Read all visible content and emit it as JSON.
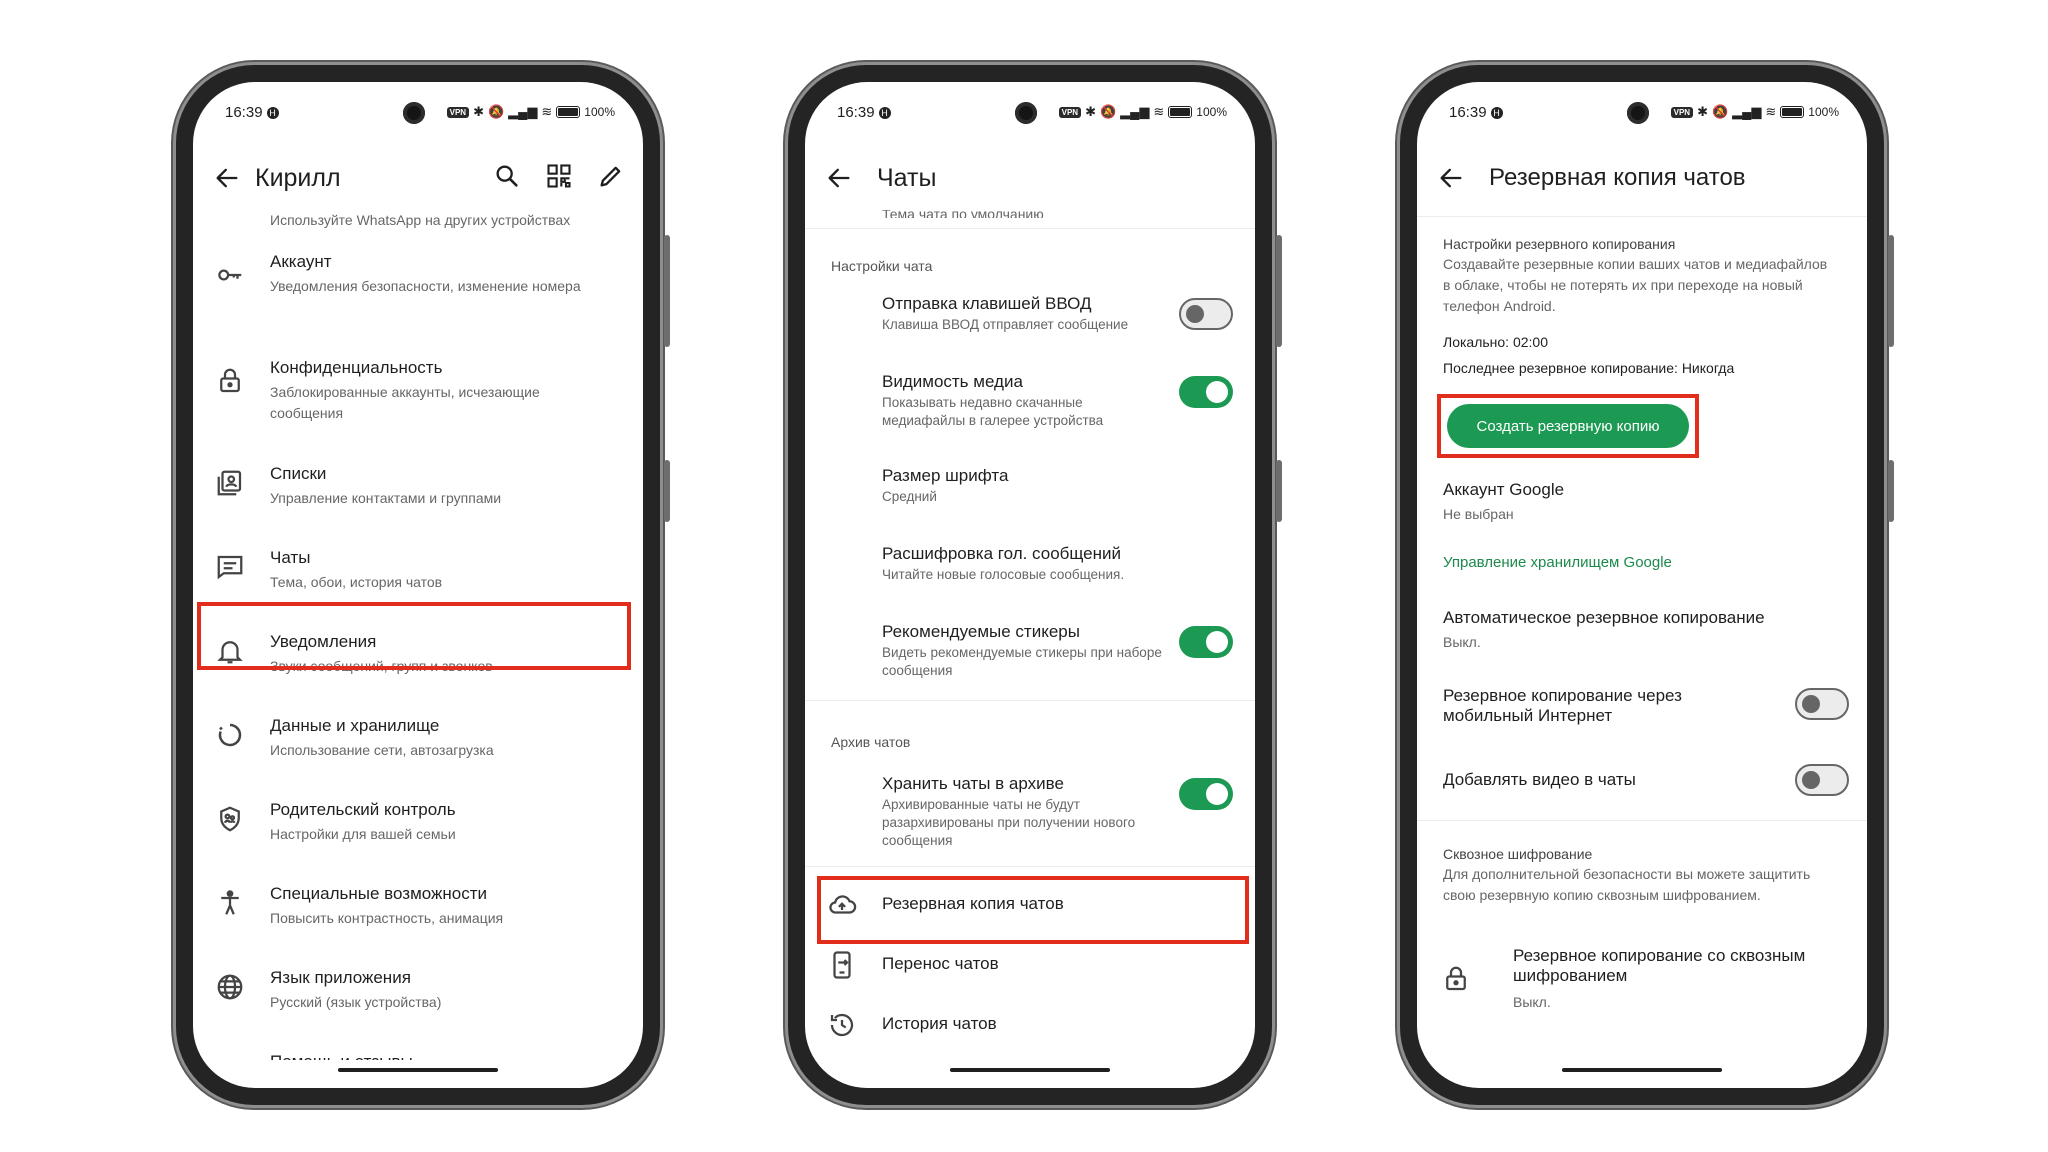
{
  "status": {
    "time": "16:39",
    "battery": "100%",
    "vpn": "VPN"
  },
  "screen1": {
    "title": "Кирилл",
    "top_cut": "Используйте WhatsApp на других устройствах",
    "items": [
      {
        "label": "Аккаунт",
        "sub": "Уведомления безопасности, изменение номера",
        "icon": "key-icon"
      },
      {
        "label": "Конфиденциальность",
        "sub": "Заблокированные аккаунты, исчезающие сообщения",
        "icon": "lock-icon"
      },
      {
        "label": "Списки",
        "sub": "Управление контактами и группами",
        "icon": "contacts-list-icon"
      },
      {
        "label": "Чаты",
        "sub": "Тема, обои, история чатов",
        "icon": "chat-icon"
      },
      {
        "label": "Уведомления",
        "sub": "Звуки сообщений, групп и звонков",
        "icon": "bell-icon"
      },
      {
        "label": "Данные и хранилище",
        "sub": "Использование сети, автозагрузка",
        "icon": "storage-circle-icon"
      },
      {
        "label": "Родительский контроль",
        "sub": "Настройки для вашей семьи",
        "icon": "family-shield-icon"
      },
      {
        "label": "Специальные возможности",
        "sub": "Повысить контрастность, анимация",
        "icon": "accessibility-icon"
      },
      {
        "label": "Язык приложения",
        "sub": "Русский (язык устройства)",
        "icon": "globe-icon"
      },
      {
        "label": "Помощь и отзывы",
        "sub": "",
        "icon": "help-icon"
      }
    ]
  },
  "screen2": {
    "title": "Чаты",
    "top_cut": "Тема чата по умолчанию",
    "section_chat": "Настройки чата",
    "enter_send": {
      "label": "Отправка клавишей ВВОД",
      "sub": "Клавиша ВВОД отправляет сообщение",
      "state": "off"
    },
    "media_visibility": {
      "label": "Видимость медиа",
      "sub": "Показывать недавно скачанные медиафайлы в галерее устройства",
      "state": "on"
    },
    "font_size": {
      "label": "Размер шрифта",
      "sub": "Средний"
    },
    "voice_transcripts": {
      "label": "Расшифровка гол. сообщений",
      "sub": "Читайте новые голосовые сообщения."
    },
    "suggested_stickers": {
      "label": "Рекомендуемые стикеры",
      "sub": "Видеть рекомендуемые стикеры при наборе сообщения",
      "state": "on"
    },
    "section_archive": "Архив чатов",
    "keep_archived": {
      "label": "Хранить чаты в архиве",
      "sub": "Архивированные чаты не будут разархивированы при получении нового сообщения",
      "state": "on"
    },
    "chat_backup": "Резервная копия чатов",
    "transfer_chats": "Перенос чатов",
    "chat_history": "История чатов"
  },
  "screen3": {
    "title": "Резервная копия чатов",
    "section_backup": "Настройки резервного копирования",
    "backup_desc": "Создавайте резервные копии ваших чатов и медиафайлов в облаке, чтобы не потерять их при переходе на новый телефон Android.",
    "local": "Локально: 02:00",
    "last_backup": "Последнее резервное копирование: Никогда",
    "backup_button": "Создать резервную копию",
    "google_account": {
      "label": "Аккаунт Google",
      "sub": "Не выбран"
    },
    "manage_storage": "Управление хранилищем Google",
    "auto_backup": {
      "label": "Автоматическое резервное копирование",
      "sub": "Выкл."
    },
    "cellular_backup": {
      "label": "Резервное копирование через мобильный Интернет",
      "state": "off"
    },
    "include_videos": {
      "label": "Добавлять видео в чаты",
      "state": "off"
    },
    "section_e2e": "Сквозное шифрование",
    "e2e_desc": "Для дополнительной безопасности вы можете защитить свою резервную копию сквозным шифрованием.",
    "e2e_backup": {
      "label": "Резервное копирование со сквозным шифрованием",
      "sub": "Выкл."
    }
  },
  "colors": {
    "accent": "#1c9a54",
    "highlight": "#e32d1c"
  }
}
